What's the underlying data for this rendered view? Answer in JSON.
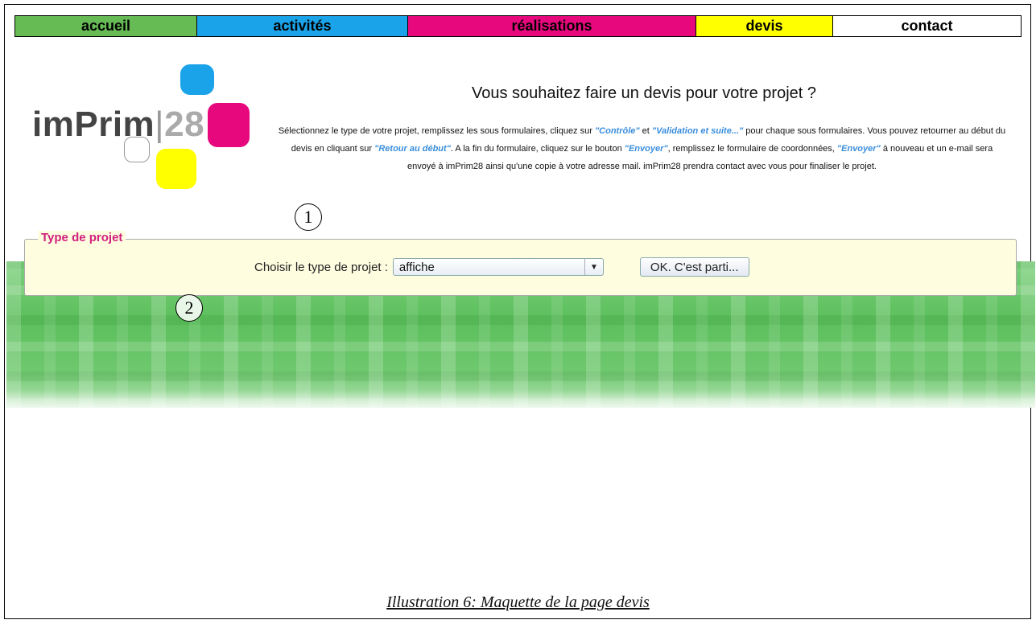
{
  "nav": {
    "items": [
      {
        "label": "accueil",
        "color": "#66bb55"
      },
      {
        "label": "activités",
        "color": "#1aa3e8"
      },
      {
        "label": "réalisations",
        "color": "#e8087e"
      },
      {
        "label": "devis",
        "color": "#ffff00"
      },
      {
        "label": "contact",
        "color": "#ffffff"
      }
    ]
  },
  "logo": {
    "text": "imPrim",
    "separator": "|",
    "number": "28"
  },
  "header": {
    "title": "Vous souhaitez faire un devis pour votre projet ?"
  },
  "intro": {
    "p1": "Sélectionnez le type de votre projet, remplissez les sous formulaires, cliquez sur ",
    "kw1": "\"Contrôle\"",
    "p2": " et ",
    "kw2": "\"Validation et suite...\"",
    "p3": " pour chaque sous formulaires. Vous pouvez retourner au début du devis en cliquant sur ",
    "kw3": "\"Retour au début\"",
    "p4": ". A la fin du formulaire, cliquez sur le bouton ",
    "kw4": "\"Envoyer\"",
    "p5": ", remplissez le formulaire de coordonnées, ",
    "kw5": "\"Envoyer\"",
    "p6": " à nouveau et un e-mail sera envoyé à imPrim28 ainsi qu'une copie à votre adresse mail. imPrim28 prendra contact avec vous pour finaliser le projet."
  },
  "markers": {
    "one": "1",
    "two": "2"
  },
  "form": {
    "legend": "Type de projet",
    "label": "Choisir le type de projet :",
    "selected": "affiche",
    "button": "OK. C'est parti..."
  },
  "caption": "Illustration 6: Maquette de la page devis",
  "colors": {
    "accent_magenta": "#d0207e",
    "link_blue": "#3a8edc",
    "panel_bg": "#fefde0"
  }
}
